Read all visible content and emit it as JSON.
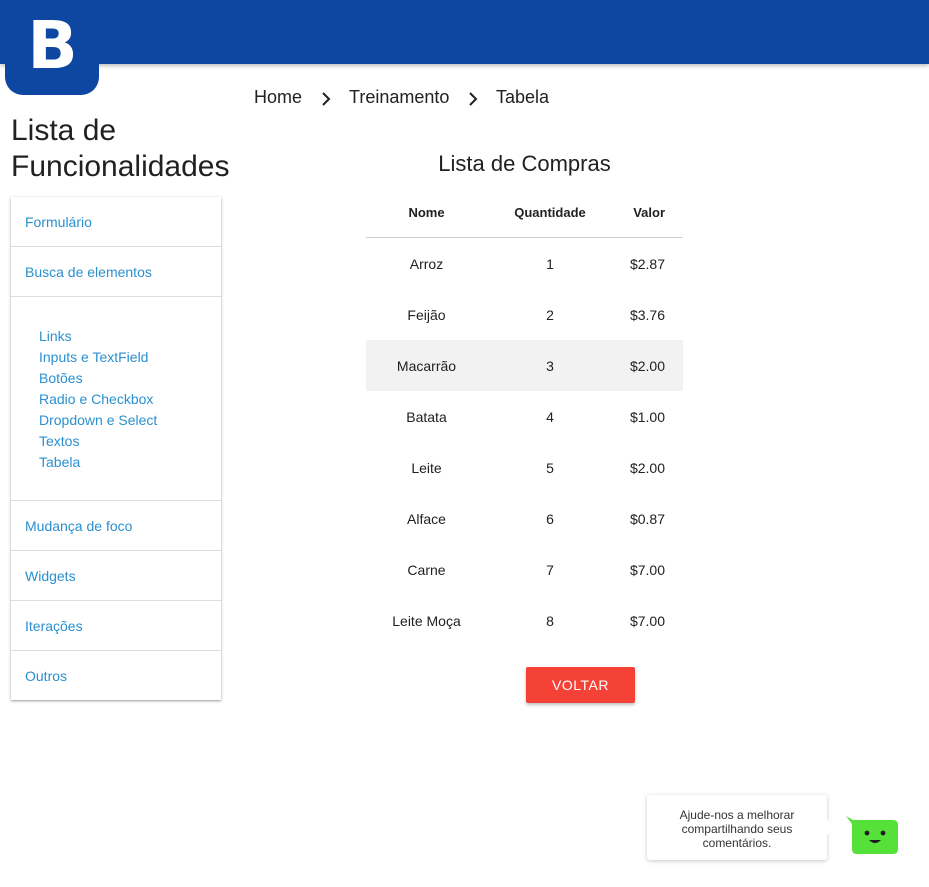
{
  "logo": {
    "letter": "B"
  },
  "breadcrumb": [
    {
      "label": "Home"
    },
    {
      "label": "Treinamento"
    },
    {
      "label": "Tabela"
    }
  ],
  "sidebar": {
    "title": "Lista de Funcionalidades",
    "items": [
      {
        "label": "Formulário"
      },
      {
        "label": "Busca de elementos"
      }
    ],
    "subitems": [
      {
        "label": "Links"
      },
      {
        "label": "Inputs e TextField"
      },
      {
        "label": "Botões"
      },
      {
        "label": "Radio e Checkbox"
      },
      {
        "label": "Dropdown e Select"
      },
      {
        "label": "Textos"
      },
      {
        "label": "Tabela"
      }
    ],
    "items_after": [
      {
        "label": "Mudança de foco"
      },
      {
        "label": "Widgets"
      },
      {
        "label": "Iterações"
      },
      {
        "label": "Outros"
      }
    ]
  },
  "table": {
    "title": "Lista de Compras",
    "headers": [
      "Nome",
      "Quantidade",
      "Valor"
    ],
    "rows": [
      [
        "Arroz",
        "1",
        "$2.87"
      ],
      [
        "Feijão",
        "2",
        "$3.76"
      ],
      [
        "Macarrão",
        "3",
        "$2.00"
      ],
      [
        "Batata",
        "4",
        "$1.00"
      ],
      [
        "Leite",
        "5",
        "$2.00"
      ],
      [
        "Alface",
        "6",
        "$0.87"
      ],
      [
        "Carne",
        "7",
        "$7.00"
      ],
      [
        "Leite Moça",
        "8",
        "$7.00"
      ]
    ],
    "highlighted_row": 3
  },
  "actions": {
    "back_label": "VOLTAR"
  },
  "feedback": {
    "message": "Ajude-nos a melhorar compartilhando seus comentários.",
    "icon": "chat-bot-icon"
  },
  "colors": {
    "header": "#0d47a1",
    "link": "#2a90cf",
    "button": "#f44336",
    "chat_bot": "#56e03a"
  }
}
